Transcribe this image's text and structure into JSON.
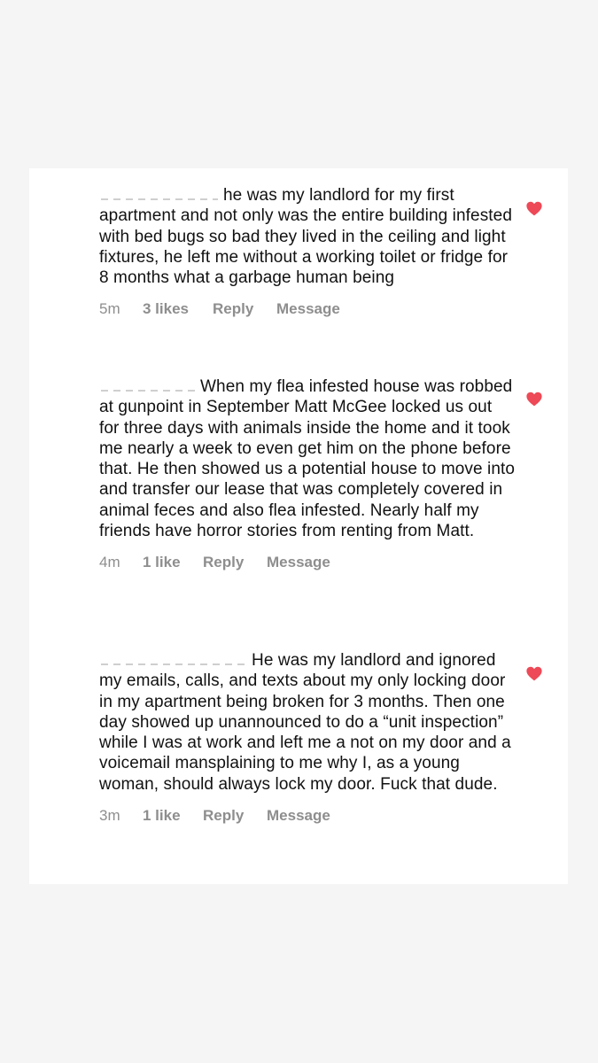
{
  "comments": [
    {
      "text": "he was my landlord for my first apartment and not only was the entire building infested with bed bugs so bad they lived in the ceiling and light fixtures, he left me without a working toilet or fridge for 8 months what a garbage human being",
      "time": "5m",
      "likes": "3 likes",
      "reply": "Reply",
      "message": "Message"
    },
    {
      "text": "When my flea infested house was robbed at gunpoint in September Matt McGee locked us out for three days with animals inside the home and it took me nearly a week to even get him on the phone before that. He then showed us a potential house to move into and transfer our lease that was completely covered in animal feces and also flea infested. Nearly half my friends have horror stories from renting from Matt.",
      "time": "4m",
      "likes": "1 like",
      "reply": "Reply",
      "message": "Message"
    },
    {
      "text": "He was my landlord and ignored my emails, calls, and texts about my only locking door in my apartment being broken for 3 months. Then one day showed up unannounced to do a “unit inspection” while I was at work and left me a not on my door and a voicemail mansplaining to me why I, as a young woman, should always lock my door. Fuck that dude.",
      "time": "3m",
      "likes": "1 like",
      "reply": "Reply",
      "message": "Message"
    }
  ],
  "colors": {
    "heart": "#ed4956",
    "meta": "#8e8e8e",
    "text": "#111111"
  },
  "icons": {
    "like": "heart-icon"
  }
}
